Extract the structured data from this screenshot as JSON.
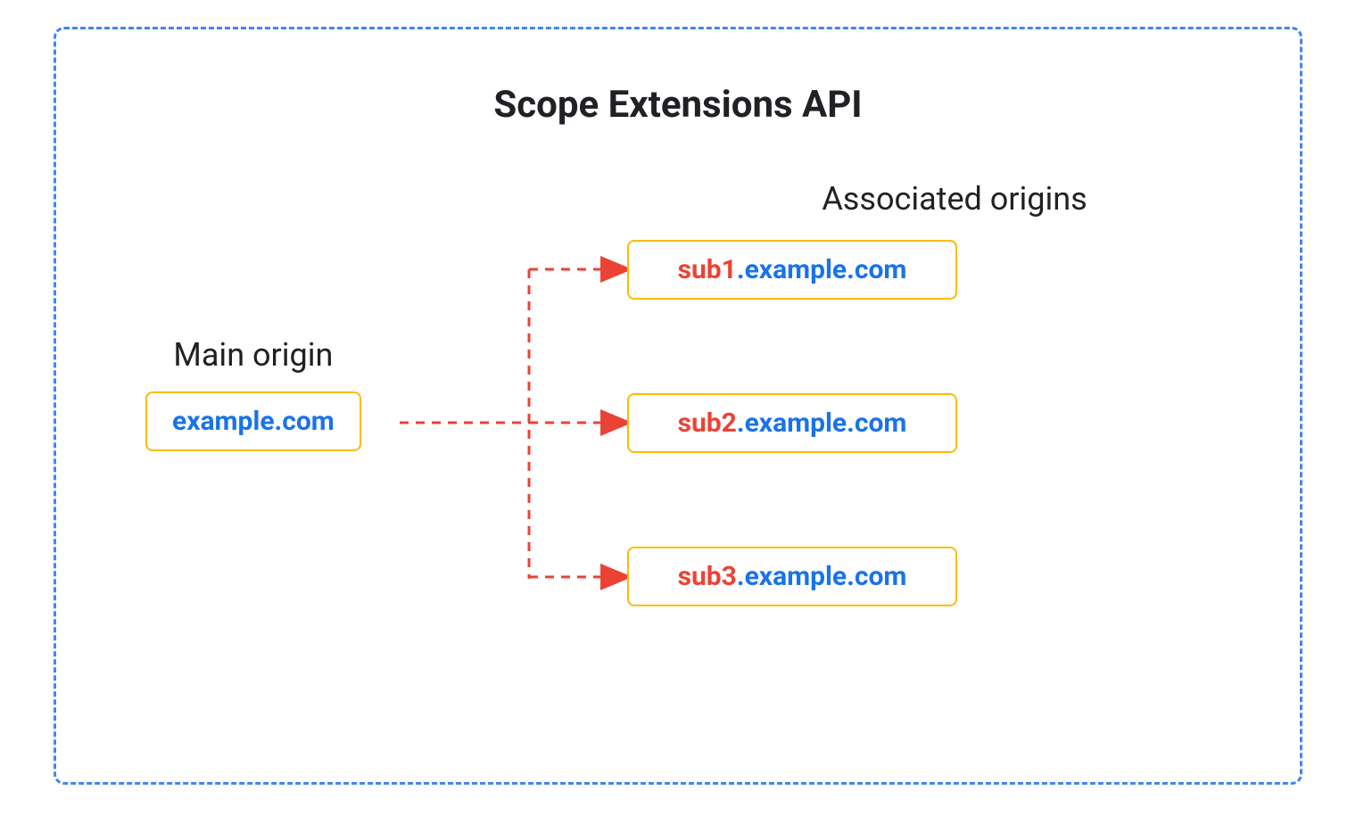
{
  "title": "Scope Extensions API",
  "main_origin": {
    "label": "Main origin",
    "domain": "example.com"
  },
  "associated_origins": {
    "label": "Associated origins",
    "items": [
      {
        "prefix": "sub1",
        "suffix": ".example.com"
      },
      {
        "prefix": "sub2",
        "suffix": ".example.com"
      },
      {
        "prefix": "sub3",
        "suffix": ".example.com"
      }
    ]
  },
  "colors": {
    "border_blue": "#4285F4",
    "box_border": "#FBBC04",
    "text_blue": "#1A73E8",
    "text_red": "#EA4335",
    "arrow_red": "#EA4335"
  }
}
